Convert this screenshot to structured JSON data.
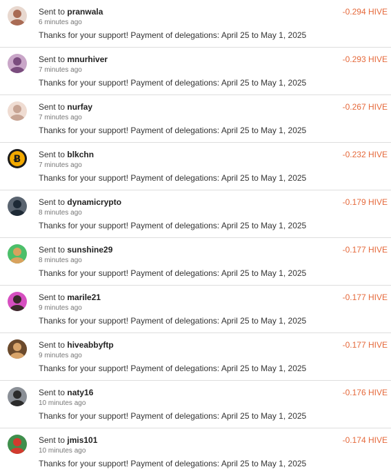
{
  "transfers": [
    {
      "prefix": "Sent to",
      "user": "pranwala",
      "time": "6 minutes ago",
      "memo": "Thanks for your support! Payment of delegations: April 25 to May 1, 2025",
      "amount": "-0.294 HIVE",
      "avatar_icon": "user-avatar-icon",
      "avatar_colors": [
        "#e8d8cf",
        "#a96b54"
      ]
    },
    {
      "prefix": "Sent to",
      "user": "mnurhiver",
      "time": "7 minutes ago",
      "memo": "Thanks for your support! Payment of delegations: April 25 to May 1, 2025",
      "amount": "-0.293 HIVE",
      "avatar_icon": "user-avatar-icon",
      "avatar_colors": [
        "#c9a6c8",
        "#7a4c7e"
      ]
    },
    {
      "prefix": "Sent to",
      "user": "nurfay",
      "time": "7 minutes ago",
      "memo": "Thanks for your support! Payment of delegations: April 25 to May 1, 2025",
      "amount": "-0.267 HIVE",
      "avatar_icon": "user-avatar-icon",
      "avatar_colors": [
        "#efdcd2",
        "#c7a494"
      ]
    },
    {
      "prefix": "Sent to",
      "user": "blkchn",
      "time": "7 minutes ago",
      "memo": "Thanks for your support! Payment of delegations: April 25 to May 1, 2025",
      "amount": "-0.232 HIVE",
      "avatar_icon": "bitcoin-icon",
      "avatar_colors": [
        "#1a1a1a",
        "#f2a900"
      ]
    },
    {
      "prefix": "Sent to",
      "user": "dynamicrypto",
      "time": "8 minutes ago",
      "memo": "Thanks for your support! Payment of delegations: April 25 to May 1, 2025",
      "amount": "-0.179 HIVE",
      "avatar_icon": "user-avatar-icon",
      "avatar_colors": [
        "#5a6470",
        "#1e2a36"
      ]
    },
    {
      "prefix": "Sent to",
      "user": "sunshine29",
      "time": "8 minutes ago",
      "memo": "Thanks for your support! Payment of delegations: April 25 to May 1, 2025",
      "amount": "-0.177 HIVE",
      "avatar_icon": "user-avatar-icon",
      "avatar_colors": [
        "#4cbf6a",
        "#d9a25e"
      ]
    },
    {
      "prefix": "Sent to",
      "user": "marile21",
      "time": "9 minutes ago",
      "memo": "Thanks for your support! Payment of delegations: April 25 to May 1, 2025",
      "amount": "-0.177 HIVE",
      "avatar_icon": "user-avatar-icon",
      "avatar_colors": [
        "#d64fc0",
        "#3a2a2a"
      ]
    },
    {
      "prefix": "Sent to",
      "user": "hiveabbyftp",
      "time": "9 minutes ago",
      "memo": "Thanks for your support! Payment of delegations: April 25 to May 1, 2025",
      "amount": "-0.177 HIVE",
      "avatar_icon": "user-avatar-icon",
      "avatar_colors": [
        "#6b4a2c",
        "#d8a46a"
      ]
    },
    {
      "prefix": "Sent to",
      "user": "naty16",
      "time": "10 minutes ago",
      "memo": "Thanks for your support! Payment of delegations: April 25 to May 1, 2025",
      "amount": "-0.176 HIVE",
      "avatar_icon": "user-avatar-icon",
      "avatar_colors": [
        "#8a8f96",
        "#2b2b2b"
      ]
    },
    {
      "prefix": "Sent to",
      "user": "jmis101",
      "time": "10 minutes ago",
      "memo": "Thanks for your support! Payment of delegations: April 25 to May 1, 2025",
      "amount": "-0.174 HIVE",
      "avatar_icon": "user-avatar-icon",
      "avatar_colors": [
        "#3f8f4c",
        "#d23a2e"
      ]
    }
  ],
  "colors": {
    "amount": "#e5683a",
    "divider": "#dddddd",
    "time": "#777777"
  }
}
